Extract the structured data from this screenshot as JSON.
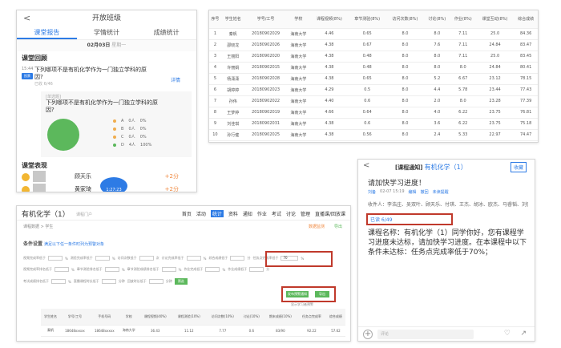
{
  "mobile_report": {
    "title": "开放班级",
    "tabs": [
      "课堂报告",
      "学情统计",
      "成绩统计"
    ],
    "date": "02月03日",
    "date_note": "星期一",
    "section_review": "课堂回顾",
    "item_time": "15:44",
    "item_badge": "投票",
    "question": "下列哪项不是有机化学作为一门独立学科的原因?",
    "question_sub": "已收 6/46",
    "detail_link": "详情",
    "card_tag": "[单选题]",
    "card_question": "下列哪项不是有机化学作为一门独立学科的原因?",
    "options": [
      {
        "label": "A",
        "count": "0人",
        "pct": "0%",
        "color": "#f0ad4e"
      },
      {
        "label": "B",
        "count": "0人",
        "pct": "0%",
        "color": "#f0ad4e"
      },
      {
        "label": "C",
        "count": "0人",
        "pct": "0%",
        "color": "#f0ad4e"
      },
      {
        "label": "D",
        "count": "4人",
        "pct": "100%",
        "color": "#5cb85c"
      }
    ],
    "section_perf": "课堂表现",
    "students": [
      {
        "name": "顾天乐",
        "score": "+2分"
      },
      {
        "name": "黄家琦",
        "score": "+2分"
      }
    ],
    "timer": "1:27:23"
  },
  "stats_table": {
    "headers": [
      "序号",
      "学生姓名",
      "学号/工号",
      "学校",
      "课程视频(8%)",
      "章节测验(8%)",
      "访问次数(8%)",
      "讨论(8%)",
      "作业(8%)",
      "课堂互动(8%)",
      "综合成绩"
    ],
    "rows": [
      [
        "1",
        "秦帆",
        "20180902029",
        "海南大学",
        "4.46",
        "0.65",
        "8.0",
        "8.0",
        "7.11",
        "25.0",
        "84.36"
      ],
      [
        "2",
        "邵晓龙",
        "20180902026",
        "海南大学",
        "4.38",
        "0.67",
        "8.0",
        "7.6",
        "7.11",
        "24.84",
        "83.47"
      ],
      [
        "3",
        "王丽阳",
        "20180902020",
        "海南大学",
        "4.38",
        "0.48",
        "8.0",
        "8.0",
        "7.11",
        "25.0",
        "83.45"
      ],
      [
        "4",
        "许丽娟",
        "20180902015",
        "海南大学",
        "4.38",
        "0.48",
        "8.0",
        "8.0",
        "8.0",
        "24.84",
        "80.41"
      ],
      [
        "5",
        "杨潇潇",
        "20180902028",
        "海南大学",
        "4.38",
        "0.65",
        "8.0",
        "5.2",
        "6.67",
        "23.12",
        "78.15"
      ],
      [
        "6",
        "胡婷婷",
        "20180902023",
        "海南大学",
        "4.29",
        "0.5",
        "8.0",
        "4.4",
        "5.78",
        "23.44",
        "77.43"
      ],
      [
        "7",
        "孙伟",
        "20180902022",
        "海南大学",
        "4.40",
        "0.6",
        "8.0",
        "2.0",
        "8.0",
        "23.28",
        "77.39"
      ],
      [
        "8",
        "王梦婷",
        "20180902019",
        "海南大学",
        "4.66",
        "0.64",
        "8.0",
        "4.0",
        "6.22",
        "23.75",
        "76.81"
      ],
      [
        "9",
        "刘佳琪",
        "20180902031",
        "海南大学",
        "4.38",
        "0.6",
        "8.0",
        "3.6",
        "6.22",
        "23.75",
        "75.18"
      ],
      [
        "10",
        "孙行健",
        "20180902025",
        "海南大学",
        "4.38",
        "0.56",
        "8.0",
        "2.4",
        "5.33",
        "22.97",
        "74.47"
      ]
    ]
  },
  "course_page": {
    "title": "有机化学（1）",
    "subtitle": "课程门户",
    "nav": [
      "首页",
      "活动",
      "统计",
      "资料",
      "通知",
      "作业",
      "考试",
      "讨论",
      "管理",
      "直播课/回放课"
    ],
    "breadcrumb": "课程数据 > 学生",
    "link_monitor": "数据监测",
    "link_export": "导出",
    "condition_label": "条件设置",
    "condition_hint": "满足以下任一条件时列为预警对象",
    "filters_row1": [
      "视频完成率低于",
      "%",
      "测验完成率低于",
      "%",
      "访问次数低于",
      "次",
      "讨论完成率低于",
      "%",
      "综合成绩低于",
      "分",
      "任务点完成率低于",
      "70",
      "%"
    ],
    "filters_row2": [
      "视频完成率排名低于",
      "%",
      "章节测验排名低于",
      "%",
      "章节测验成绩排名低于",
      "%",
      "作业完成低于",
      "%",
      "作业成绩低于",
      "分"
    ],
    "filters_row3": [
      "考试成绩排名低于",
      "%",
      "直播课程时长低于",
      "分钟",
      "回放时长低于",
      "分钟"
    ],
    "btn_search": "筛选",
    "btn_notify": "发布预警通知",
    "btn_export": "导出",
    "sort_hint": "显示学习者预警",
    "table_headers": [
      "学生姓名",
      "学号/工号",
      "手机号码",
      "学校",
      "课程视频(40%)",
      "课程测验(10%)",
      "访问次数(10%)",
      "讨论(10%)",
      "期末成绩(10%)",
      "任务点完成率",
      "综合成绩"
    ],
    "table_row": [
      "秦帆",
      "18648xxxxx",
      "18648xxxxx",
      "海南大学",
      "36.43",
      "11.12",
      "7.77",
      "0.6",
      "83/90",
      "92.22",
      "57.62"
    ]
  },
  "notification": {
    "tag": "[课程通知]",
    "course": "有机化学（1）",
    "collect": "收藏",
    "subject": "请加快学习进度！",
    "author": "刘备",
    "time": "02-07 15:19",
    "edit": "编辑",
    "withdraw": "撤回",
    "unread": "未读提醒",
    "receivers": "收件人：李浩庄、吴双叶、顾天乐、付琪、王杰、胡冰、欧杰、马睿韬、刘强、王语涵、严...",
    "read_count": "已读 6/49",
    "body": "课程名称：有机化学（1）同学你好，您有课程学习进度未达标，请加快学习进度。在本课程中以下条件未达标：任务点完成率低于70%；",
    "comment_placeholder": "评论"
  }
}
